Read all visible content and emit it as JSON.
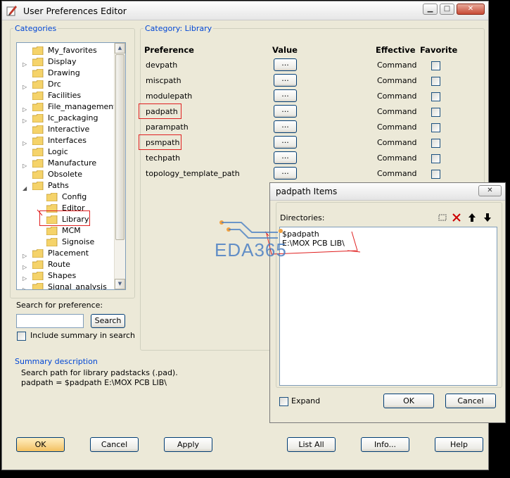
{
  "window": {
    "title": "User Preferences Editor",
    "app_icon": "pen-edit-icon",
    "minimize": "minimize-icon",
    "maximize": "maximize-icon",
    "close": "close-icon"
  },
  "categories": {
    "legend": "Categories",
    "items": [
      {
        "label": "My_favorites",
        "expandable": false,
        "level": 0
      },
      {
        "label": "Display",
        "expandable": true,
        "level": 0
      },
      {
        "label": "Drawing",
        "expandable": false,
        "level": 0
      },
      {
        "label": "Drc",
        "expandable": true,
        "level": 0
      },
      {
        "label": "Facilities",
        "expandable": false,
        "level": 0
      },
      {
        "label": "File_management",
        "expandable": true,
        "level": 0
      },
      {
        "label": "Ic_packaging",
        "expandable": true,
        "level": 0
      },
      {
        "label": "Interactive",
        "expandable": false,
        "level": 0
      },
      {
        "label": "Interfaces",
        "expandable": true,
        "level": 0
      },
      {
        "label": "Logic",
        "expandable": false,
        "level": 0
      },
      {
        "label": "Manufacture",
        "expandable": true,
        "level": 0
      },
      {
        "label": "Obsolete",
        "expandable": false,
        "level": 0
      },
      {
        "label": "Paths",
        "expandable": true,
        "expanded": true,
        "level": 0
      },
      {
        "label": "Config",
        "expandable": false,
        "level": 1
      },
      {
        "label": "Editor",
        "expandable": false,
        "level": 1
      },
      {
        "label": "Library",
        "expandable": false,
        "level": 1,
        "selected": true
      },
      {
        "label": "MCM",
        "expandable": false,
        "level": 1
      },
      {
        "label": "Signoise",
        "expandable": false,
        "level": 1
      },
      {
        "label": "Placement",
        "expandable": true,
        "level": 0
      },
      {
        "label": "Route",
        "expandable": true,
        "level": 0
      },
      {
        "label": "Shapes",
        "expandable": true,
        "level": 0
      },
      {
        "label": "Signal_analysis",
        "expandable": true,
        "level": 0
      }
    ]
  },
  "search": {
    "label": "Search for preference:",
    "value": "",
    "button": "Search",
    "include_summary_label": "Include summary in search",
    "include_summary_checked": false
  },
  "category_panel": {
    "legend": "Category:  Library",
    "headers": {
      "preference": "Preference",
      "value": "Value",
      "effective": "Effective",
      "favorite": "Favorite"
    },
    "rows": [
      {
        "name": "devpath",
        "value": "...",
        "effective": "Command",
        "favorite": false
      },
      {
        "name": "miscpath",
        "value": "...",
        "effective": "Command",
        "favorite": false
      },
      {
        "name": "modulepath",
        "value": "...",
        "effective": "Command",
        "favorite": false
      },
      {
        "name": "padpath",
        "value": "...",
        "effective": "Command",
        "favorite": false,
        "highlighted": true
      },
      {
        "name": "parampath",
        "value": "...",
        "effective": "Command",
        "favorite": false
      },
      {
        "name": "psmpath",
        "value": "...",
        "effective": "Command",
        "favorite": false,
        "highlighted": true
      },
      {
        "name": "techpath",
        "value": "...",
        "effective": "Command",
        "favorite": false
      },
      {
        "name": "topology_template_path",
        "value": "...",
        "effective": "Command",
        "favorite": false
      }
    ]
  },
  "summary": {
    "legend": "Summary description",
    "line1": "Search path for library padstacks (.pad).",
    "line2": "padpath = $padpath E:\\MOX PCB LIB\\"
  },
  "bottom_buttons": {
    "ok": "OK",
    "cancel": "Cancel",
    "apply": "Apply",
    "list_all": "List All",
    "info": "Info...",
    "help": "Help"
  },
  "popup": {
    "title": "padpath Items",
    "close": "close-icon",
    "directories_label": "Directories:",
    "tools": [
      "new-item-icon",
      "delete-icon",
      "move-up-icon",
      "move-down-icon"
    ],
    "directories": [
      "$padpath",
      "E:\\MOX PCB LIB\\"
    ],
    "expand_label": "Expand",
    "expand_checked": false,
    "ok": "OK",
    "cancel": "Cancel"
  },
  "watermark": {
    "text": "EDA365"
  },
  "colors": {
    "legend_blue": "#0046d5",
    "highlight_red": "#e02020",
    "watermark_blue": "#4a7fc4",
    "watermark_orange": "#f0a040"
  }
}
